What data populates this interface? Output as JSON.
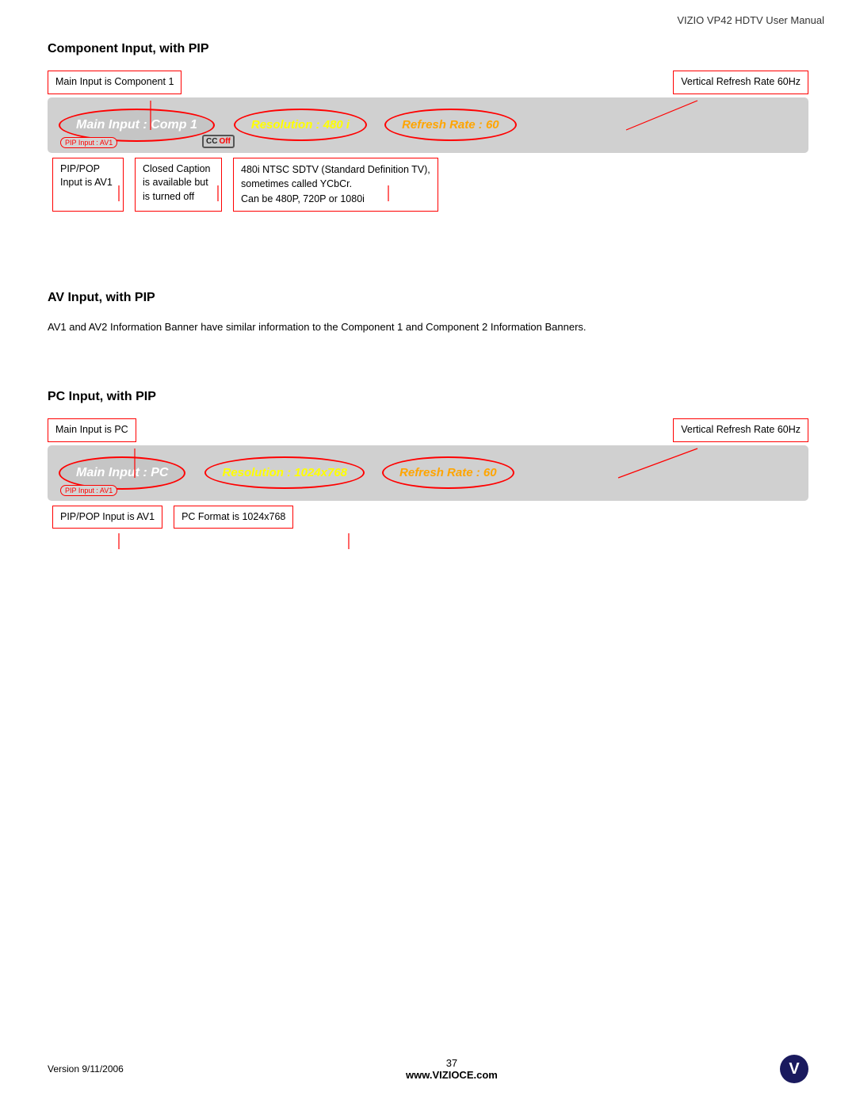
{
  "header": {
    "title": "VIZIO VP42 HDTV User Manual"
  },
  "section1": {
    "title": "Component Input, with PIP",
    "banner": {
      "main_input": "Main Input : Comp 1",
      "resolution": "Resolution : 480 i",
      "refresh": "Refresh Rate : 60",
      "pip_label": "PIP Input : AV1",
      "cc_label": "CC",
      "off_label": "Off"
    },
    "anno_top_left": "Main Input is Component 1",
    "anno_top_right": "Vertical Refresh Rate 60Hz",
    "anno_bottom": [
      {
        "text": "PIP/POP\nInput is AV1"
      },
      {
        "text": "Closed  Caption\nis  available  but\nis turned off"
      },
      {
        "text": "480i NTSC SDTV (Standard Definition TV),\nsometimes called YCbCr.\nCan be 480P, 720P or 1080i"
      }
    ]
  },
  "section2": {
    "title": "AV Input, with PIP",
    "description": "AV1  and  AV2  Information  Banner  have  similar  information  to  the  Component  1  and  Component  2  Information Banners."
  },
  "section3": {
    "title": "PC Input, with PIP",
    "banner": {
      "main_input": "Main Input : PC",
      "resolution": "Resolution : 1024x768",
      "refresh": "Refresh Rate : 60",
      "pip_label": "PIP Input : AV1"
    },
    "anno_top_left": "Main Input is PC",
    "anno_top_right": "Vertical Refresh Rate 60Hz",
    "anno_bottom": [
      {
        "text": "PIP/POP Input is AV1"
      },
      {
        "text": "PC Format is 1024x768"
      }
    ]
  },
  "footer": {
    "version": "Version 9/11/2006",
    "page_number": "37",
    "website": "www.VIZIOCE.com",
    "logo": "V"
  }
}
